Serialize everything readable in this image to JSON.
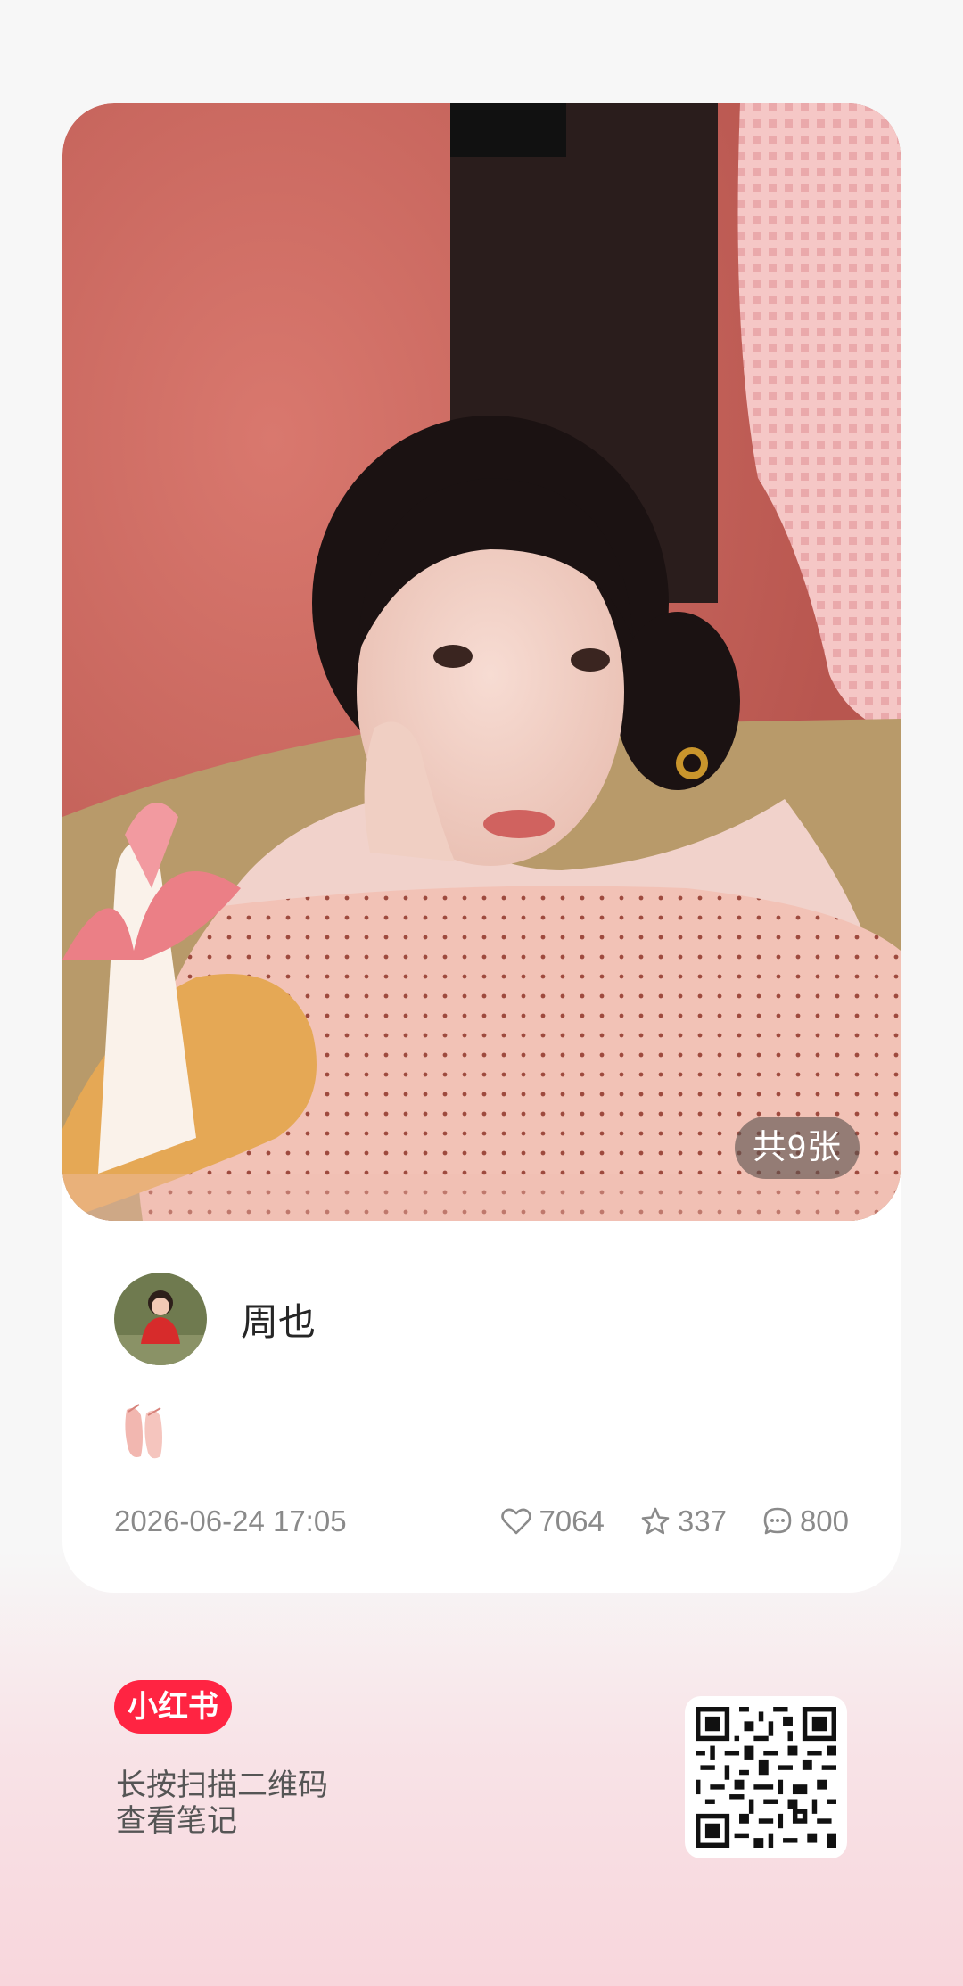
{
  "cover": {
    "image_alt": "笔记封面",
    "image_count_badge": "共9张"
  },
  "author": {
    "name": "周也",
    "avatar_icon": "avatar-icon"
  },
  "note": {
    "body_emoji": "🩰",
    "date": "2026-06-24 17:05"
  },
  "stats": {
    "likes": "7064",
    "collects": "337",
    "comments": "800",
    "like_icon": "heart-icon",
    "collect_icon": "star-icon",
    "comment_icon": "comment-icon"
  },
  "footer": {
    "brand": "小红书",
    "hint_line1": "长按扫描二维码",
    "hint_line2": "查看笔记",
    "qr_icon": "qr-code-icon"
  },
  "colors": {
    "brand_red": "#ff2442",
    "meta_gray": "#8a8a8a",
    "card_bg": "#ffffff"
  }
}
